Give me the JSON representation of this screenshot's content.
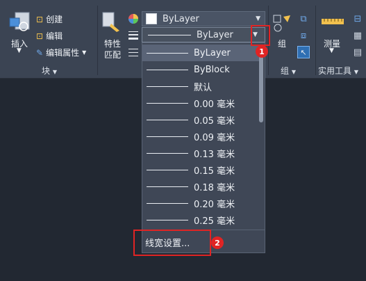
{
  "ribbon": {
    "insert_label": "插入",
    "block_actions": [
      {
        "label": "创建"
      },
      {
        "label": "编辑"
      },
      {
        "label": "编辑属性"
      }
    ],
    "block_panel_title": "块",
    "match_props_label": [
      "特性",
      "匹配"
    ],
    "color_value": "ByLayer",
    "lineweight_value": "ByLayer",
    "group_label": "组",
    "group_panel_title": "组",
    "measure_label": "测量",
    "utility_panel_title": "实用工具"
  },
  "dropdown": {
    "options": [
      "ByLayer",
      "ByBlock",
      "默认",
      "0.00 毫米",
      "0.05 毫米",
      "0.09 毫米",
      "0.13 毫米",
      "0.15 毫米",
      "0.18 毫米",
      "0.20 毫米",
      "0.25 毫米"
    ],
    "selected_index": 0,
    "footer": "线宽设置..."
  },
  "callouts": {
    "one": "1",
    "two": "2"
  },
  "colors": {
    "accent_red": "#e02424",
    "ribbon_bg": "#3b4453",
    "canvas_bg": "#222832"
  }
}
